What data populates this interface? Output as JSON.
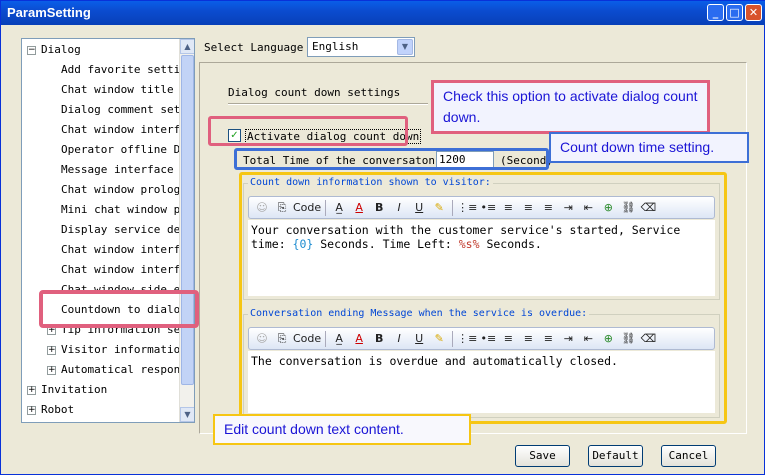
{
  "window": {
    "title": "ParamSetting",
    "min": "_",
    "max": "□",
    "close": "✕"
  },
  "tree": {
    "root": [
      {
        "label": "Dialog",
        "exp": "−"
      },
      {
        "label": "Add favorite setting"
      },
      {
        "label": "Chat window title se"
      },
      {
        "label": "Dialog comment setti"
      },
      {
        "label": "Chat window interfac"
      },
      {
        "label": "Operator offline Dis"
      },
      {
        "label": "Message interface se"
      },
      {
        "label": "Chat window prologue"
      },
      {
        "label": "Mini chat window pro"
      },
      {
        "label": "Display service deps"
      },
      {
        "label": "Chat window interfac"
      },
      {
        "label": "Chat window interfac"
      },
      {
        "label": "Chat window side edg"
      },
      {
        "label": "Countdown to dialog"
      },
      {
        "label": "Tip information sett",
        "exp": "+"
      },
      {
        "label": "Visitor information",
        "exp": "+"
      },
      {
        "label": "Automatical response",
        "exp": "+"
      },
      {
        "label": "Invitation",
        "exp": "+"
      },
      {
        "label": "Robot",
        "exp": "+"
      }
    ]
  },
  "lang": {
    "label": "Select Language",
    "value": "English"
  },
  "section": {
    "title": "Dialog count down settings"
  },
  "activate": {
    "label": "Activate dialog count down",
    "checked": "✓"
  },
  "total": {
    "label": "Total Time of the conversaton:",
    "value": "1200",
    "unit": "(Second)"
  },
  "editor1": {
    "legend": "Count down information shown to visitor:",
    "line1": "Your conversation with the customer service's started, Service",
    "line2a": "time: ",
    "tok1": "{0}",
    "line2b": " Seconds. Time Left: ",
    "tok2": "%s%",
    "line2c": " Seconds."
  },
  "editor2": {
    "legend": "Conversation ending Message when the service is overdue:",
    "text": "The conversation is overdue and automatically closed."
  },
  "toolbar": [
    "☺",
    "⎘",
    "Code",
    "A̲",
    "A",
    "B",
    "I",
    "U",
    "✎",
    "⋮≡",
    "•≡",
    "≡",
    "≡",
    "≡",
    "⇥",
    "⇤",
    "⊕",
    "⛓",
    "⌫"
  ],
  "buttons": {
    "save": "Save",
    "default": "Default",
    "cancel": "Cancel"
  },
  "notes": {
    "activate": "Check this option to activate dialog count down.",
    "time": "Count down time setting.",
    "edit": "Edit count down text content."
  },
  "colors": {
    "pink": "#e0607e",
    "blue": "#3d6fd6",
    "yellow": "#f6c613"
  }
}
